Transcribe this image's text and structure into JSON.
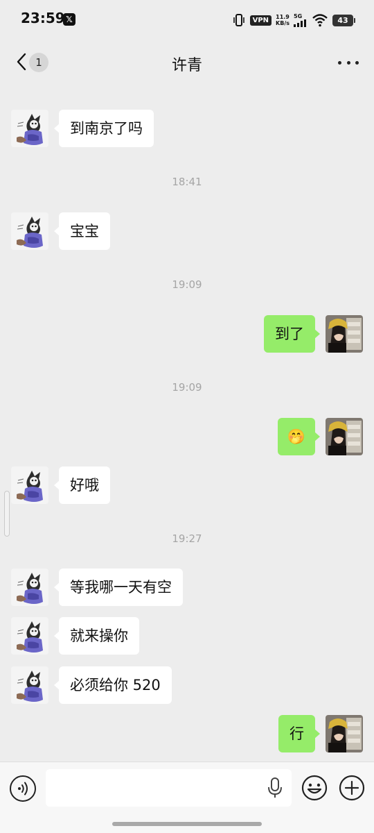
{
  "status_bar": {
    "time": "23:59",
    "x_label": "𝕏",
    "vpn": "VPN",
    "speed_value": "11.9",
    "speed_unit": "KB/s",
    "network": "5G",
    "battery": "43"
  },
  "nav": {
    "unread_count": "1",
    "title": "许青"
  },
  "messages": [
    {
      "side": "in",
      "text": "到南京了吗"
    },
    {
      "type": "time",
      "text": "18:41"
    },
    {
      "side": "in",
      "text": "宝宝"
    },
    {
      "type": "time",
      "text": "19:09"
    },
    {
      "side": "out",
      "text": "到了"
    },
    {
      "type": "time",
      "text": "19:09"
    },
    {
      "side": "out",
      "text": "🤭"
    },
    {
      "side": "in",
      "text": "好哦"
    },
    {
      "type": "time",
      "text": "19:27"
    },
    {
      "side": "in",
      "text": "等我哪一天有空"
    },
    {
      "side": "in",
      "text": "就来操你"
    },
    {
      "side": "in",
      "text": "必须给你 520"
    },
    {
      "side": "out",
      "text": "行"
    }
  ],
  "input": {
    "value": "",
    "placeholder": ""
  },
  "colors": {
    "background": "#ededed",
    "incoming_bubble": "#ffffff",
    "outgoing_bubble": "#95ec69",
    "timestamp": "#a5a5a5"
  },
  "icons": {
    "back": "chevron-left-icon",
    "more": "ellipsis-icon",
    "voice": "voice-icon",
    "mic": "microphone-icon",
    "emoji": "emoji-icon",
    "plus": "plus-icon"
  }
}
